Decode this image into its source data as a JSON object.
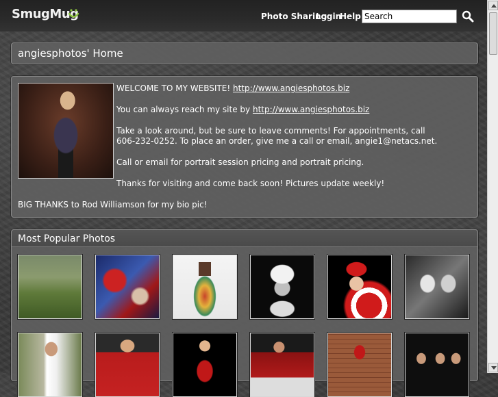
{
  "header": {
    "logo_text": "SmugMug",
    "nav": [
      {
        "label": "Photo Sharing"
      },
      {
        "label": "Login"
      },
      {
        "label": "Help"
      }
    ],
    "search_value": "Search",
    "accent": "#8dc63f"
  },
  "page": {
    "title": "angiesphotos' Home"
  },
  "welcome": {
    "line1_text": "WELCOME TO MY WEBSITE!",
    "line1_link": "http://www.angiesphotos.biz",
    "line2_text": "You can always reach my site by",
    "line2_link": "http://www.angiesphotos.biz",
    "para3_line1": "Take a look around, but be sure to leave comments! For appointments, call",
    "para3_line2": "606-232-0252. To place an order, give me a call or email, angie1@netacs.net.",
    "para4": "Call or email for portrait session pricing and portrait pricing.",
    "para5": "Thanks for visiting and come back soon! Pictures update weekly!",
    "para6": "BIG THANKS to Rod Williamson for my bio pic!"
  },
  "popular": {
    "title": "Most Popular Photos"
  }
}
